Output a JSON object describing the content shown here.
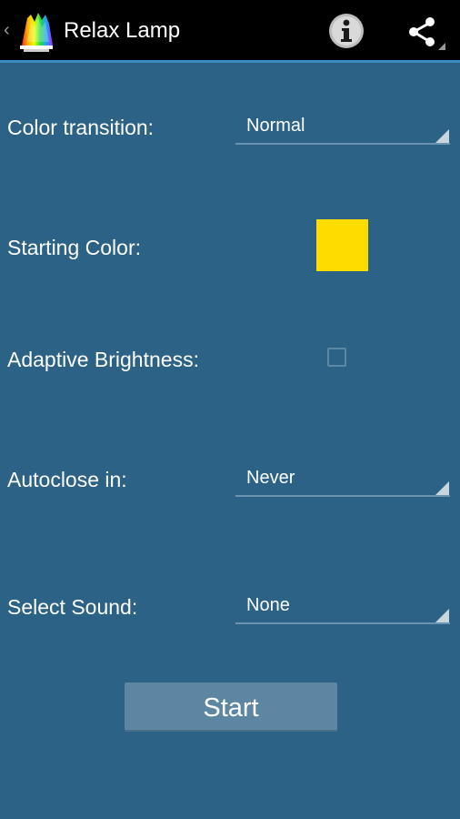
{
  "app": {
    "title": "Relax Lamp",
    "up_caret": "‹"
  },
  "actions": {
    "info_icon": "info-icon",
    "share_icon": "share-icon"
  },
  "settings": {
    "color_transition": {
      "label": "Color transition:",
      "value": "Normal"
    },
    "starting_color": {
      "label": "Starting Color:",
      "color": "#ffdc00"
    },
    "adaptive_brightness": {
      "label": "Adaptive Brightness:",
      "checked": false
    },
    "autoclose": {
      "label": "Autoclose in:",
      "value": "Never"
    },
    "sound": {
      "label": "Select Sound:",
      "value": "None"
    }
  },
  "start_button": {
    "label": "Start"
  },
  "colors": {
    "background": "#2c6286",
    "action_bar": "#000000",
    "accent_line": "#3b8ec2",
    "button": "#5d86a2"
  }
}
